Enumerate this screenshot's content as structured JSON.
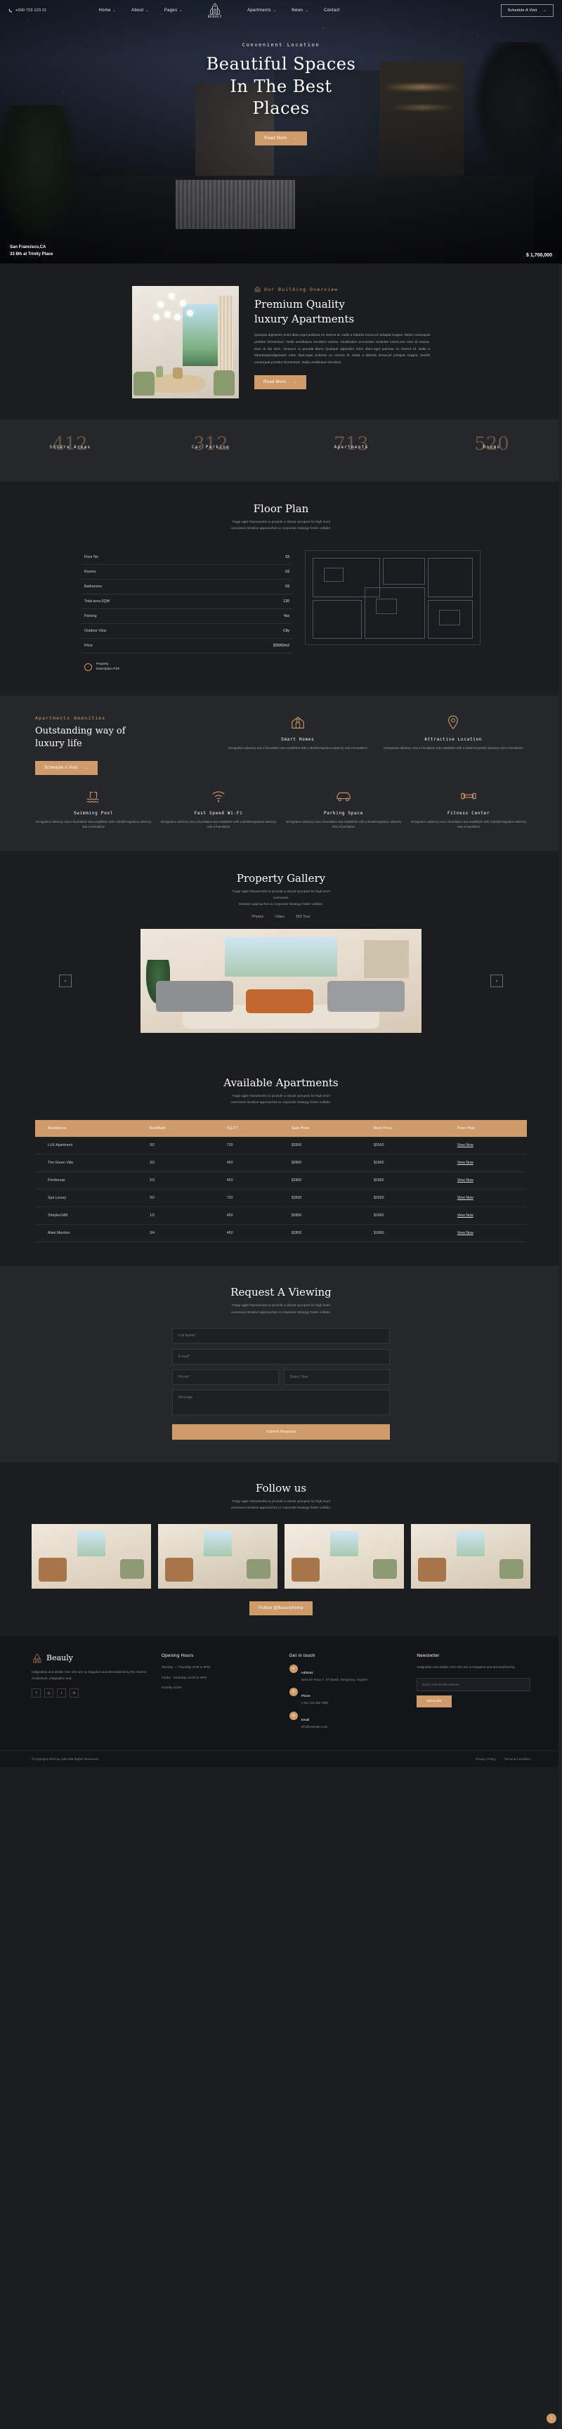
{
  "header": {
    "phone": "+000 723 123 21",
    "phone_icon": "phone-icon",
    "brand": "BEAULY",
    "nav": [
      {
        "label": "Home",
        "caret": "⌄"
      },
      {
        "label": "About",
        "caret": "⌄"
      },
      {
        "label": "Pages",
        "caret": "⌄"
      },
      {
        "label": "Apartments",
        "caret": "⌄"
      },
      {
        "label": "News",
        "caret": "⌄"
      },
      {
        "label": "Contact",
        "caret": ""
      }
    ],
    "cta": "Schedule A Visit",
    "cta_arrow": "→"
  },
  "hero": {
    "eyebrow": "Convenient Location",
    "title_line1": "Beautiful Spaces",
    "title_line2": "In The Best",
    "title_line3": "Places",
    "button": "Read More",
    "button_arrow": "→",
    "location_line1": "San Francisco,CA",
    "location_line2": "33 8th at Trinity Place",
    "price": "$ 1,700,000"
  },
  "about": {
    "eyebrow": "Our Building Overview",
    "eyebrow_icon": "home-outline-icon",
    "title_line1": "Premium Quality",
    "title_line2": "luxury Apartments",
    "paragraph": "Quisque dignissim enim diam,eget pulvinar ex viverra id. Nulla a lobortis lectus,id volutpat magna. Morbi consequat porttitor fermentum. Nulla vestibulum tincidunt viverra. Vestibulum accumsan molestie lorem,non sem id massa. Duis at dui sem. Vivamus ut gravida libero Quisque dignissim enim diam,eget pulvinar ex viverra id. Nulla a lobortisQuisdignissim enim diam,eget pulvinar ex viverra id. Nulla a lobortis lectus,id volutpat magna. Morbti consequat porttitor fermentum. Nulla vestibulum tincidunt",
    "button": "Read More",
    "button_arrow": "→"
  },
  "counters": [
    {
      "number": "412",
      "label": "Square Areas"
    },
    {
      "number": "312",
      "label": "Car Parking"
    },
    {
      "number": "713",
      "label": "Apartments"
    },
    {
      "number": "520",
      "label": "Rooms"
    }
  ],
  "floor_plan": {
    "title": "Floor Plan",
    "desc_line1": "Trage agile frameworks to provide a robust synopsis for high level",
    "desc_line2": "overviews Iterative approaches to corporate strategy foster collabe.",
    "rows": [
      {
        "label": "Floor No",
        "value": "03"
      },
      {
        "label": "Rooms",
        "value": "03"
      },
      {
        "label": "Bathrooms",
        "value": "03"
      },
      {
        "label": "Total area,SQM",
        "value": "120"
      },
      {
        "label": "Parking",
        "value": "Yes"
      },
      {
        "label": "Outdoor View",
        "value": "City"
      },
      {
        "label": "Price",
        "value": "$3500/m2"
      }
    ],
    "download_icon": "download-icon",
    "download_line1": "Property",
    "download_line2": "Description PDF",
    "plan_image_alt": "floor-plan-drawing"
  },
  "amenities": {
    "eyebrow": "Apartments Amenities",
    "title_line1": "Outstanding way of",
    "title_line2": "luxury life",
    "button": "Schedule A Visit",
    "button_arrow": "→",
    "items": [
      {
        "icon": "smart-home-icon",
        "title": "Smart Homes",
        "desc": "Immigration advisory visa a foundation was establishe with a idealimmigration advisory visa a foundation"
      },
      {
        "icon": "location-pin-icon",
        "title": "Attractive Location",
        "desc": "Immigration advisory visa a foundation was establishe with a idealimmigration advisory visa a foundation"
      },
      {
        "icon": "swimming-pool-icon",
        "title": "Swimming Pool",
        "desc": "Immigration advisory visa a foundation was establishe with a idealimmigration advisory visa a foundation"
      },
      {
        "icon": "wifi-icon",
        "title": "Fast Speed Wi-Fi",
        "desc": "Immigration advisory visa a foundation was establishe with a idealimmigration advisory visa a foundation"
      },
      {
        "icon": "car-parking-icon",
        "title": "Parking Space",
        "desc": "Immigration advisory visa a foundation was establishe with a idealimmigration advisory visa a foundation"
      },
      {
        "icon": "dumbbell-icon",
        "title": "Fitness Center",
        "desc": "Immigration advisory visa a foundation was establishe with a idealimmigration advisory visa a foundation"
      }
    ]
  },
  "gallery": {
    "title": "Property Gallery",
    "desc_line1": "Trage agile frameworks to provide a robust synopsis for high level",
    "desc_line2": "overviews.",
    "desc_line3": "Iterative approaches to corporate strategy foster collabe.",
    "tabs": [
      {
        "label": "Photos",
        "active": true
      },
      {
        "label": "Video",
        "active": false
      },
      {
        "label": "360 Tour",
        "active": false
      }
    ],
    "prev_arrow": "‹",
    "next_arrow": "›"
  },
  "available": {
    "title": "Available Apartments",
    "desc_line1": "Trage agile frameworks to provide a robust synopsis for high level",
    "desc_line2": "overviews Iterative approaches to corporate strategy foster collabe.",
    "columns": [
      "Residence",
      "Bed/Bath",
      "SQ.FT",
      "Sale Price",
      "Rent Price",
      "Floor Plan"
    ],
    "rows": [
      [
        "LUX Apartment",
        "3/2",
        "720",
        "$3500",
        "$2500",
        "View Now"
      ],
      [
        "The Green Villa",
        "3/3",
        "450",
        "$2800",
        "$1800",
        "View Now"
      ],
      [
        "Penthouse",
        "2/3",
        "450",
        "$2800",
        "$1800",
        "View Now"
      ],
      [
        "Spa Luxury",
        "3/2",
        "720",
        "$3500",
        "$2500",
        "View Now"
      ],
      [
        "SImplex2AB",
        "1/2",
        "450",
        "$2800",
        "$1800",
        "View Now"
      ],
      [
        "Alani Mention",
        "3/4",
        "450",
        "$2800",
        "$1800",
        "View Now"
      ]
    ]
  },
  "request": {
    "title": "Request A Viewing",
    "desc_line1": "Trage agile frameworks to provide a robust synopsis for high level",
    "desc_line2": "overviews Iterative approaches to corporate strategy foster collabe.",
    "name_placeholder": "Full Name*",
    "email_placeholder": "E-mail*",
    "phone_placeholder": "Phone*",
    "select_placeholder": "Select Time",
    "message_placeholder": "Message",
    "submit": "Submit Request"
  },
  "follow": {
    "title": "Follow us",
    "desc_line1": "Trage agile frameworks to provide a robust synopsis for high level",
    "desc_line2": "overviews Iterative approaches to corporate strategy foster collabe.",
    "button": "Follow @Beaulyhome",
    "cards": [
      "gallery-photo-1",
      "gallery-photo-2",
      "gallery-photo-3",
      "gallery-photo-4"
    ]
  },
  "footer": {
    "brand": "Beauly",
    "brand_icon": "building-logo-icon",
    "about": "Indignation and dislike men who are so beguiled and demoralized by the charms of pleasure, indignation and.",
    "socials": [
      "facebook-icon",
      "instagram-icon",
      "twitter-icon",
      "linkedin-icon"
    ],
    "hours_title": "Opening Hours",
    "hours": [
      "Monday — Thursday 9AM to 6PM",
      "Friday - Saturday 11AM to 4PM",
      "Sunday Close"
    ],
    "touch_title": "Get in touch",
    "contacts": [
      {
        "icon": "map-pin-icon",
        "label": "Address",
        "value": "3463 km Trace 7, ST Bomb, Temporary, Angeles"
      },
      {
        "icon": "phone-icon",
        "label": "Phone",
        "value": "(+91) 123 456 7890"
      },
      {
        "icon": "mail-icon",
        "label": "Email",
        "value": "info@example.com"
      }
    ],
    "news_title": "Newsletter",
    "news_desc": "Indignation and dislike men who are so beguiled and demoralized by.",
    "news_placeholder": "Enter Your Email Address",
    "news_button": "Subscribe",
    "copyright": "©Copyright 2023 by 13scott8 Rights Reserved.",
    "links": [
      "Privacy Policy",
      "Terms & Condition"
    ],
    "to_top_icon": "arrow-up-icon"
  }
}
